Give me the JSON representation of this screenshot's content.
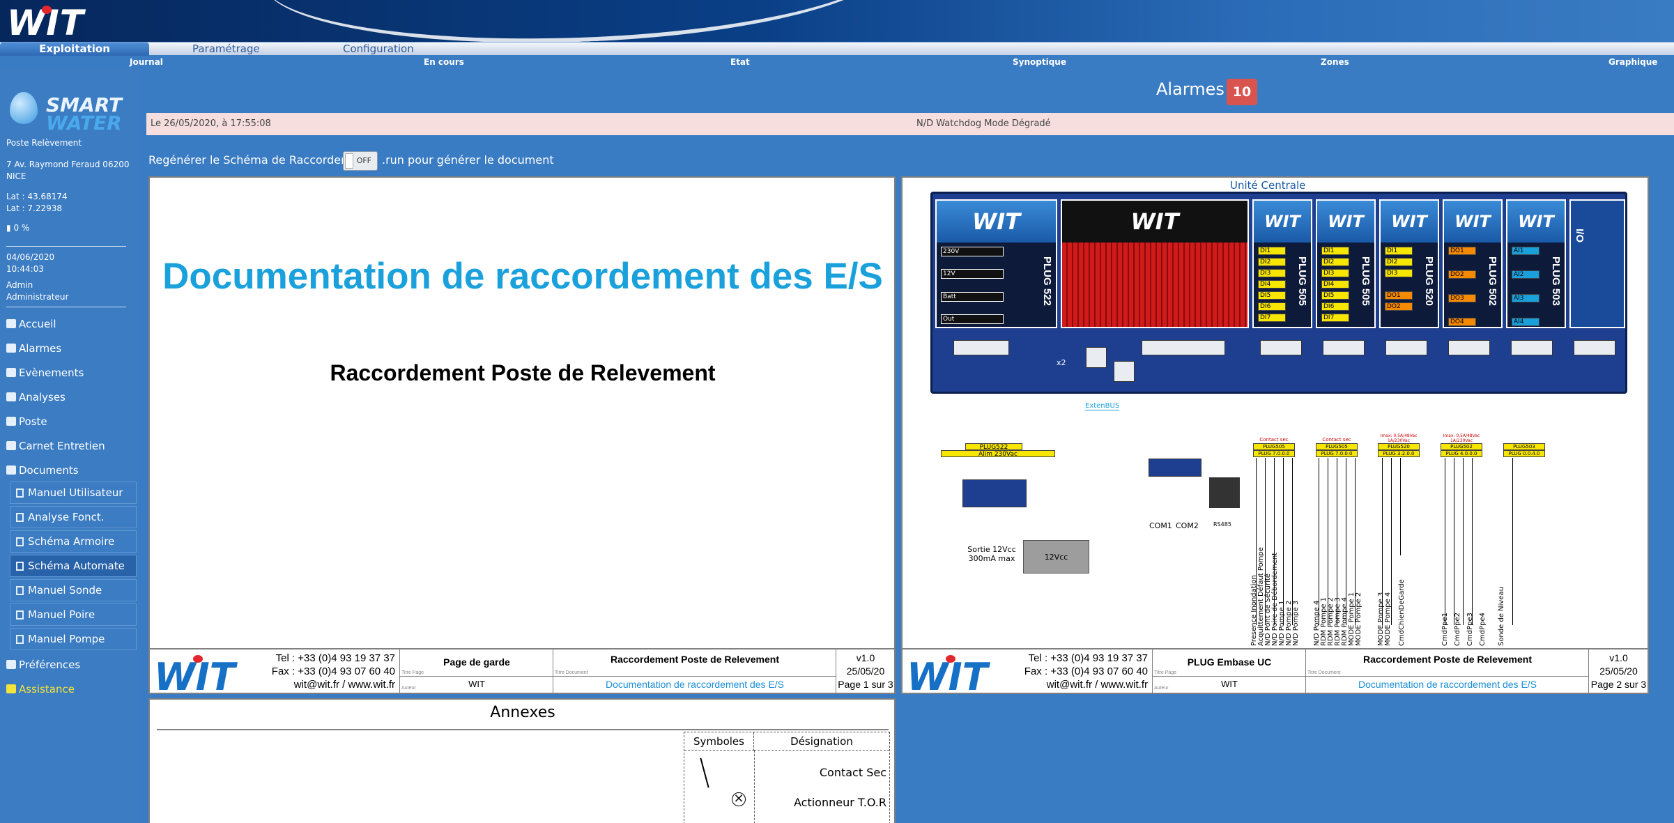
{
  "brand": {
    "logo_text": "WIT",
    "smart": "SMART",
    "water": "WATER"
  },
  "menu": {
    "items": [
      "Exploitation",
      "Paramétrage",
      "Configuration"
    ],
    "submenu": [
      "Journal",
      "En cours",
      "Etat",
      "Synoptique",
      "Zones",
      "Graphique"
    ]
  },
  "sidebar": {
    "site": "Poste Relèvement",
    "address1": "7 Av. Raymond Feraud 06200",
    "address2": "NICE",
    "lat": "Lat : 43.68174",
    "lng": "Lat : 7.22938",
    "signal": "0 %",
    "date": "04/06/2020",
    "time": "10:44:03",
    "user": "Admin",
    "role": "Administrateur",
    "nav": [
      "Accueil",
      "Alarmes",
      "Evènements",
      "Analyses",
      "Poste",
      "Carnet Entretien",
      "Documents"
    ],
    "docs": [
      "Manuel Utilisateur",
      "Analyse Fonct.",
      "Schéma Armoire",
      "Schéma Automate",
      "Manuel Sonde",
      "Manuel Poire",
      "Manuel Pompe"
    ],
    "selected_doc": "Schéma Automate",
    "bottom": [
      "Préférences",
      "Assistance"
    ]
  },
  "alarms": {
    "label": "Alarmes",
    "count": "10"
  },
  "alert": {
    "date": "Le 26/05/2020, à 17:55:08",
    "message": "N/D Watchdog Mode Dégradé"
  },
  "regen": {
    "label": "Regénérer le Schéma de Raccordement",
    "toggle": "OFF",
    "suffix": ".run pour générer le document"
  },
  "page1": {
    "title": "Documentation de raccordement des E/S",
    "subtitle": "Raccordement Poste de Relevement"
  },
  "footer": {
    "tel": "Tel : +33 (0)4 93 19 37 37",
    "fax": "Fax : +33 (0)4 93 07 60 40",
    "mail": "wit@wit.fr / www.wit.fr",
    "titre_page_lbl": "Titre Page",
    "auteur_lbl": "Auteur",
    "titre_doc_lbl": "Titre Document",
    "author": "WIT",
    "doc_title": "Raccordement Poste de Relevement",
    "doc_sub": "Documentation de raccordement des E/S",
    "version": "v1.0",
    "date": "25/05/20"
  },
  "footer1": {
    "page_title": "Page de garde",
    "page_num": "Page 1 sur 3"
  },
  "footer2": {
    "page_title": "PLUG Embase UC",
    "page_num": "Page 2 sur 3"
  },
  "schematic": {
    "title": "Unité Centrale",
    "modules": [
      "PLUG 522",
      "PLUG 505",
      "PLUG 505",
      "PLUG 520",
      "PLUG 502",
      "PLUG 503",
      "I/O"
    ],
    "plug522_labels": [
      "230V",
      "12V",
      "Batt",
      "Out"
    ],
    "plug505_labels": [
      "DI1",
      "DI2",
      "DI3",
      "DI4",
      "DI5",
      "DI6",
      "DI7"
    ],
    "plug520_labels": [
      "DI1",
      "DI2",
      "DI3",
      "DO1",
      "DO2"
    ],
    "plug502_labels": [
      "DO1",
      "DO2",
      "DO3",
      "DO4"
    ],
    "plug503_labels": [
      "AI1",
      "AI2",
      "AI3",
      "AI4"
    ],
    "extenbus": "ExtenBUS",
    "com1": "COM1",
    "com2": "COM2",
    "rs485": "RS485",
    "x2": "x2",
    "plug522_box": "PLUG522",
    "alim": "Alim 230Vac",
    "sortie": "Sortie 12Vcc",
    "sortie2": "300mA max",
    "battery": "12Vcc",
    "boxes": [
      "PLUG505",
      "PLUG505",
      "PLUG520",
      "PLUG502",
      "PLUG503"
    ],
    "box_sub": [
      "PLUG 7.0.0.0",
      "PLUG 7.0.0.0",
      "PLUG 3.2.0.0",
      "PLUG 4.0.0.0",
      "PLUG 0.0.4.0"
    ],
    "box_notes": [
      "Contact sec",
      "Contact sec",
      "Imax: 0,5A/48Vac 1A/230Vac",
      "Imax: 0,5A/48Vac 1A/230Vac",
      ""
    ],
    "signals_a": [
      "Presence Inondation",
      "Acquittement Défaut Pompe",
      "N/D Pont de Sécurité",
      "N/D Poire de Débordement",
      "N/D Pompe 1",
      "N/D Pompe 2",
      "N/D Pompe 3"
    ],
    "signals_b": [
      "N/D Pompe 4",
      "RDM Pompe 1",
      "RDM Pompe 2",
      "RDM Pompe 3",
      "RDM Pompe 4",
      "MODE Pompe 1",
      "MODE Pompe 2"
    ],
    "signals_c": [
      "MODE Pompe 3",
      "MODE Pompe 4",
      "CmdChienDeGarde"
    ],
    "signals_d": [
      "CmdPpe1",
      "CmdPpe2",
      "CmdPpe3",
      "CmdPpe4"
    ],
    "signals_e": [
      "Sonde de Niveau"
    ]
  },
  "annexes": {
    "title": "Annexes",
    "col1": "Symboles",
    "col2": "Désignation",
    "rows": [
      "Contact Sec",
      "Actionneur T.O.R"
    ]
  }
}
